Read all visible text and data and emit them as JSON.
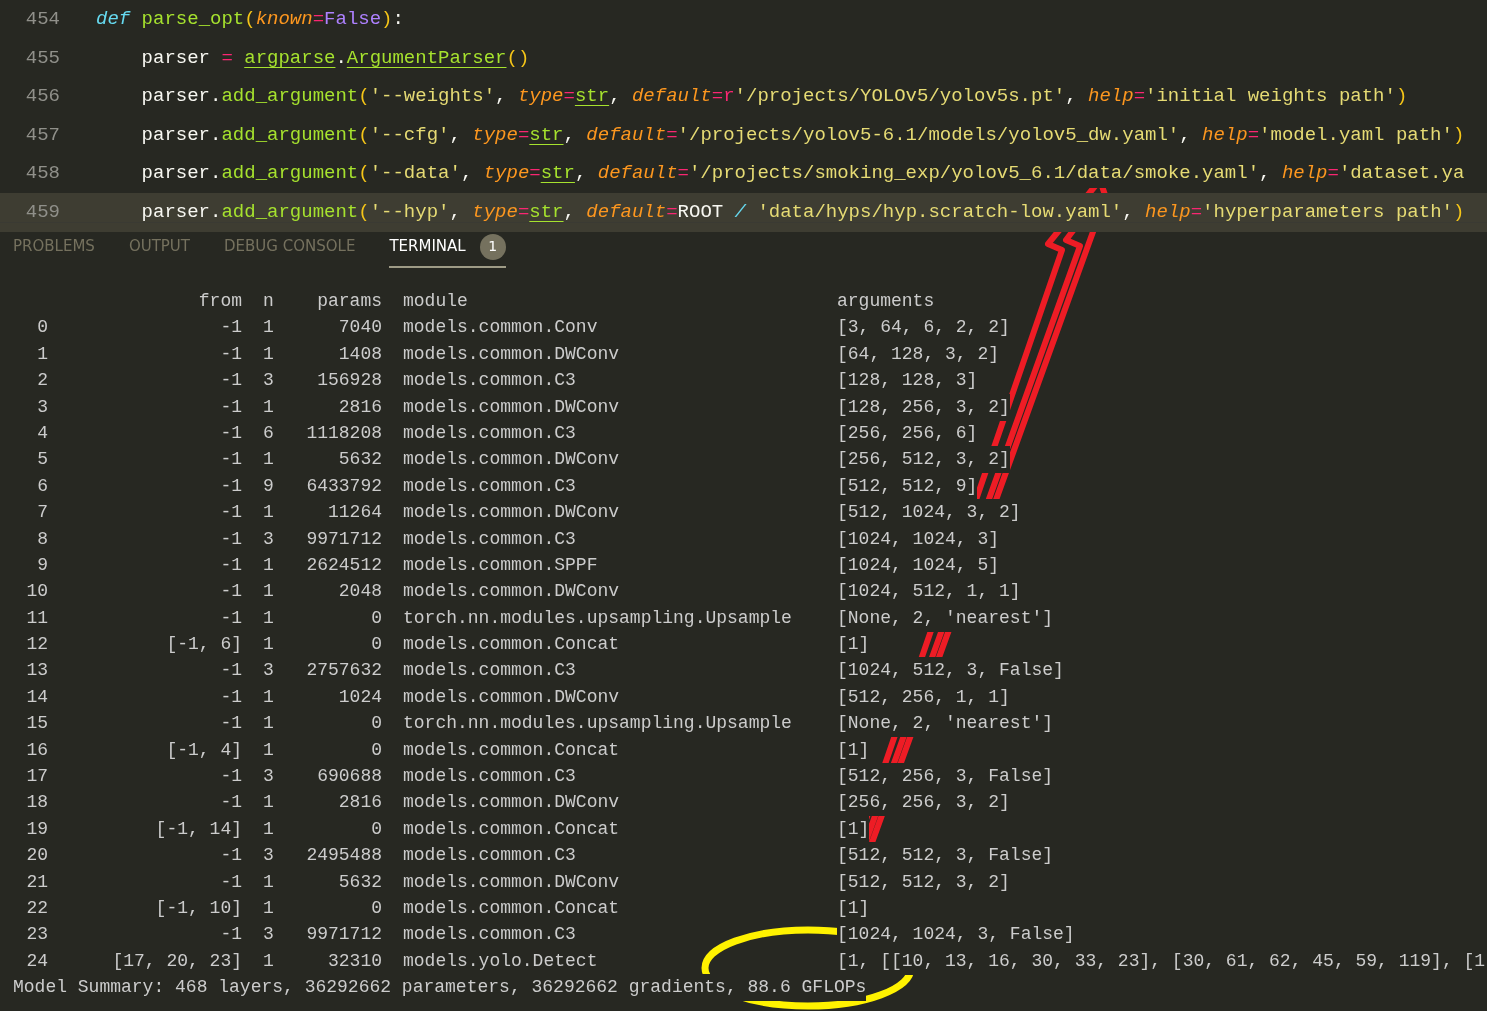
{
  "editor": {
    "lines": [
      {
        "number": "454",
        "current": false,
        "tokens": [
          {
            "kind": "kw",
            "text": "def"
          },
          {
            "kind": "fn",
            "text": " parse_opt"
          },
          {
            "kind": "paren",
            "text": "("
          },
          {
            "kind": "param",
            "text": "known"
          },
          {
            "kind": "op",
            "text": "="
          },
          {
            "kind": "const",
            "text": "False"
          },
          {
            "kind": "paren",
            "text": ")"
          },
          {
            "kind": "plain",
            "text": ":"
          }
        ]
      },
      {
        "number": "455",
        "current": false,
        "tokens": [
          {
            "kind": "plain",
            "text": "    parser "
          },
          {
            "kind": "op",
            "text": "= "
          },
          {
            "kind": "builtin",
            "text": "argparse"
          },
          {
            "kind": "plain",
            "text": "."
          },
          {
            "kind": "builtin",
            "text": "ArgumentParser"
          },
          {
            "kind": "paren",
            "text": "()"
          }
        ]
      },
      {
        "number": "456",
        "current": false,
        "tokens": [
          {
            "kind": "plain",
            "text": "    parser."
          },
          {
            "kind": "fn",
            "text": "add_argument"
          },
          {
            "kind": "paren",
            "text": "("
          },
          {
            "kind": "str",
            "text": "'--weights'"
          },
          {
            "kind": "plain",
            "text": ", "
          },
          {
            "kind": "param",
            "text": "type"
          },
          {
            "kind": "op",
            "text": "="
          },
          {
            "kind": "builtin",
            "text": "str"
          },
          {
            "kind": "plain",
            "text": ", "
          },
          {
            "kind": "param",
            "text": "default"
          },
          {
            "kind": "op",
            "text": "=r"
          },
          {
            "kind": "str",
            "text": "'/projects/YOLOv5/yolov5s.pt'"
          },
          {
            "kind": "plain",
            "text": ", "
          },
          {
            "kind": "param",
            "text": "help"
          },
          {
            "kind": "op",
            "text": "="
          },
          {
            "kind": "str",
            "text": "'initial weights path'"
          },
          {
            "kind": "paren",
            "text": ")"
          }
        ]
      },
      {
        "number": "457",
        "current": false,
        "tokens": [
          {
            "kind": "plain",
            "text": "    parser."
          },
          {
            "kind": "fn",
            "text": "add_argument"
          },
          {
            "kind": "paren",
            "text": "("
          },
          {
            "kind": "str",
            "text": "'--cfg'"
          },
          {
            "kind": "plain",
            "text": ", "
          },
          {
            "kind": "param",
            "text": "type"
          },
          {
            "kind": "op",
            "text": "="
          },
          {
            "kind": "builtin",
            "text": "str"
          },
          {
            "kind": "plain",
            "text": ", "
          },
          {
            "kind": "param",
            "text": "default"
          },
          {
            "kind": "op",
            "text": "="
          },
          {
            "kind": "str",
            "text": "'/projects/yolov5-6.1/models/yolov5_dw.yaml'"
          },
          {
            "kind": "plain",
            "text": ", "
          },
          {
            "kind": "param",
            "text": "help"
          },
          {
            "kind": "op",
            "text": "="
          },
          {
            "kind": "str",
            "text": "'model.yaml path'"
          },
          {
            "kind": "paren",
            "text": ")"
          }
        ]
      },
      {
        "number": "458",
        "current": false,
        "tokens": [
          {
            "kind": "plain",
            "text": "    parser."
          },
          {
            "kind": "fn",
            "text": "add_argument"
          },
          {
            "kind": "paren",
            "text": "("
          },
          {
            "kind": "str",
            "text": "'--data'"
          },
          {
            "kind": "plain",
            "text": ", "
          },
          {
            "kind": "param",
            "text": "type"
          },
          {
            "kind": "op",
            "text": "="
          },
          {
            "kind": "builtin",
            "text": "str"
          },
          {
            "kind": "plain",
            "text": ", "
          },
          {
            "kind": "param",
            "text": "default"
          },
          {
            "kind": "op",
            "text": "="
          },
          {
            "kind": "str",
            "text": "'/projects/smoking_exp/yolov5_6.1/data/smoke.yaml'"
          },
          {
            "kind": "plain",
            "text": ", "
          },
          {
            "kind": "param",
            "text": "help"
          },
          {
            "kind": "op",
            "text": "="
          },
          {
            "kind": "str",
            "text": "'dataset.ya"
          }
        ]
      },
      {
        "number": "459",
        "current": true,
        "tokens": [
          {
            "kind": "plain",
            "text": "    parser."
          },
          {
            "kind": "fn",
            "text": "add_argument"
          },
          {
            "kind": "paren",
            "text": "("
          },
          {
            "kind": "str",
            "text": "'--hyp'"
          },
          {
            "kind": "plain",
            "text": ", "
          },
          {
            "kind": "param",
            "text": "type"
          },
          {
            "kind": "op",
            "text": "="
          },
          {
            "kind": "builtin",
            "text": "str"
          },
          {
            "kind": "plain",
            "text": ", "
          },
          {
            "kind": "param",
            "text": "default"
          },
          {
            "kind": "op",
            "text": "="
          },
          {
            "kind": "plain",
            "text": "ROOT "
          },
          {
            "kind": "kw",
            "text": "/ "
          },
          {
            "kind": "str",
            "text": "'data/hyps/hyp.scratch-low.yaml'"
          },
          {
            "kind": "plain",
            "text": ", "
          },
          {
            "kind": "param",
            "text": "help"
          },
          {
            "kind": "op",
            "text": "="
          },
          {
            "kind": "str",
            "text": "'hyperparameters path'"
          },
          {
            "kind": "paren",
            "text": ")"
          }
        ]
      }
    ]
  },
  "panel": {
    "tabs": [
      {
        "label": "PROBLEMS",
        "selected": false
      },
      {
        "label": "OUTPUT",
        "selected": false
      },
      {
        "label": "DEBUG CONSOLE",
        "selected": false
      },
      {
        "label": "TERMINAL",
        "selected": true,
        "badge": "1"
      }
    ]
  },
  "terminal": {
    "columns": [
      "from",
      "n",
      "params",
      "module",
      "arguments"
    ],
    "rows": [
      {
        "index": "0",
        "from": "-1",
        "n": "1",
        "params": "7040",
        "module": "models.common.Conv",
        "arguments": "[3, 64, 6, 2, 2]"
      },
      {
        "index": "1",
        "from": "-1",
        "n": "1",
        "params": "1408",
        "module": "models.common.DWConv",
        "arguments": "[64, 128, 3, 2]"
      },
      {
        "index": "2",
        "from": "-1",
        "n": "3",
        "params": "156928",
        "module": "models.common.C3",
        "arguments": "[128, 128, 3]"
      },
      {
        "index": "3",
        "from": "-1",
        "n": "1",
        "params": "2816",
        "module": "models.common.DWConv",
        "arguments": "[128, 256, 3, 2]"
      },
      {
        "index": "4",
        "from": "-1",
        "n": "6",
        "params": "1118208",
        "module": "models.common.C3",
        "arguments": "[256, 256, 6]"
      },
      {
        "index": "5",
        "from": "-1",
        "n": "1",
        "params": "5632",
        "module": "models.common.DWConv",
        "arguments": "[256, 512, 3, 2]"
      },
      {
        "index": "6",
        "from": "-1",
        "n": "9",
        "params": "6433792",
        "module": "models.common.C3",
        "arguments": "[512, 512, 9]"
      },
      {
        "index": "7",
        "from": "-1",
        "n": "1",
        "params": "11264",
        "module": "models.common.DWConv",
        "arguments": "[512, 1024, 3, 2]"
      },
      {
        "index": "8",
        "from": "-1",
        "n": "3",
        "params": "9971712",
        "module": "models.common.C3",
        "arguments": "[1024, 1024, 3]"
      },
      {
        "index": "9",
        "from": "-1",
        "n": "1",
        "params": "2624512",
        "module": "models.common.SPPF",
        "arguments": "[1024, 1024, 5]"
      },
      {
        "index": "10",
        "from": "-1",
        "n": "1",
        "params": "2048",
        "module": "models.common.DWConv",
        "arguments": "[1024, 512, 1, 1]"
      },
      {
        "index": "11",
        "from": "-1",
        "n": "1",
        "params": "0",
        "module": "torch.nn.modules.upsampling.Upsample",
        "arguments": "[None, 2, 'nearest']"
      },
      {
        "index": "12",
        "from": "[-1, 6]",
        "n": "1",
        "params": "0",
        "module": "models.common.Concat",
        "arguments": "[1]"
      },
      {
        "index": "13",
        "from": "-1",
        "n": "3",
        "params": "2757632",
        "module": "models.common.C3",
        "arguments": "[1024, 512, 3, False]"
      },
      {
        "index": "14",
        "from": "-1",
        "n": "1",
        "params": "1024",
        "module": "models.common.DWConv",
        "arguments": "[512, 256, 1, 1]"
      },
      {
        "index": "15",
        "from": "-1",
        "n": "1",
        "params": "0",
        "module": "torch.nn.modules.upsampling.Upsample",
        "arguments": "[None, 2, 'nearest']"
      },
      {
        "index": "16",
        "from": "[-1, 4]",
        "n": "1",
        "params": "0",
        "module": "models.common.Concat",
        "arguments": "[1]"
      },
      {
        "index": "17",
        "from": "-1",
        "n": "3",
        "params": "690688",
        "module": "models.common.C3",
        "arguments": "[512, 256, 3, False]"
      },
      {
        "index": "18",
        "from": "-1",
        "n": "1",
        "params": "2816",
        "module": "models.common.DWConv",
        "arguments": "[256, 256, 3, 2]"
      },
      {
        "index": "19",
        "from": "[-1, 14]",
        "n": "1",
        "params": "0",
        "module": "models.common.Concat",
        "arguments": "[1]"
      },
      {
        "index": "20",
        "from": "-1",
        "n": "3",
        "params": "2495488",
        "module": "models.common.C3",
        "arguments": "[512, 512, 3, False]"
      },
      {
        "index": "21",
        "from": "-1",
        "n": "1",
        "params": "5632",
        "module": "models.common.DWConv",
        "arguments": "[512, 512, 3, 2]"
      },
      {
        "index": "22",
        "from": "[-1, 10]",
        "n": "1",
        "params": "0",
        "module": "models.common.Concat",
        "arguments": "[1]"
      },
      {
        "index": "23",
        "from": "-1",
        "n": "3",
        "params": "9971712",
        "module": "models.common.C3",
        "arguments": "[1024, 1024, 3, False]"
      },
      {
        "index": "24",
        "from": "[17, 20, 23]",
        "n": "1",
        "params": "32310",
        "module": "models.yolo.Detect",
        "arguments": "[1, [[10, 13, 16, 30, 33, 23], [30, 61, 62, 45, 59, 119], [1"
      }
    ],
    "summary": "Model Summary: 468 layers, 36292662 parameters, 36292662 gradients, 88.6 GFLOPs"
  }
}
